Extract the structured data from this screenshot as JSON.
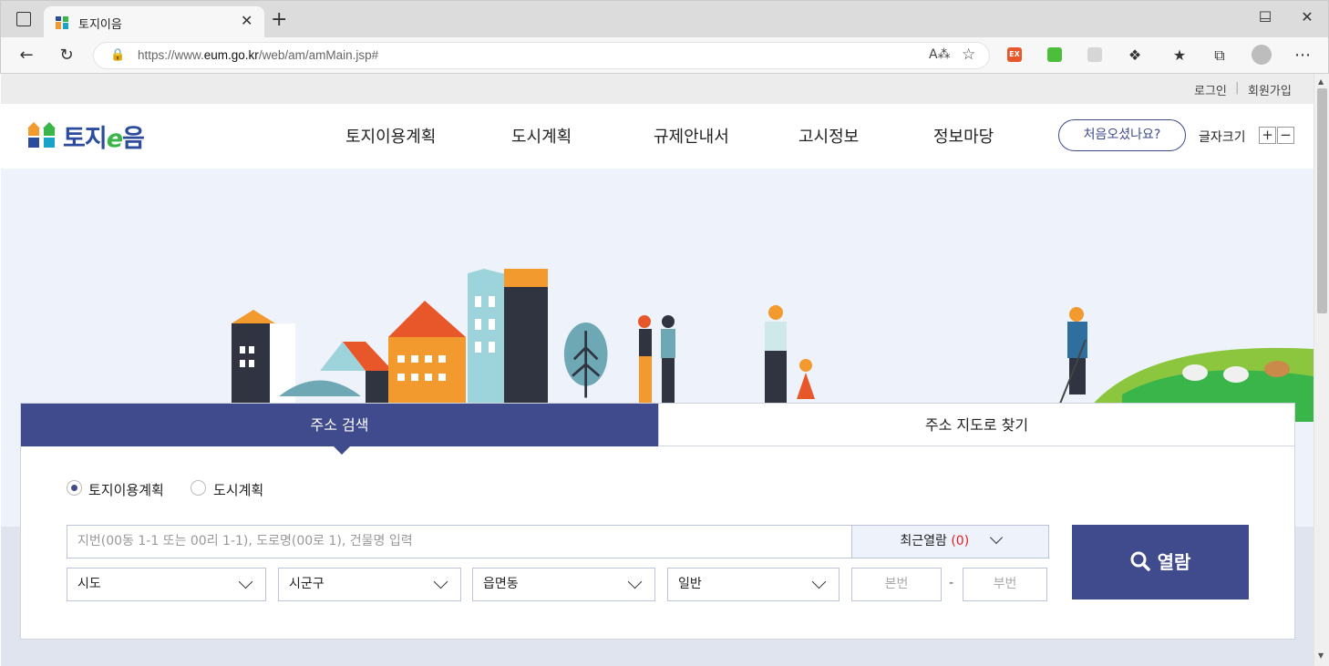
{
  "browser": {
    "tab_title": "토지이음",
    "url_prefix": "https://www.",
    "url_domain": "eum.go.kr",
    "url_path": "/web/am/amMain.jsp#",
    "new_tab": "+",
    "tab_close": "✕",
    "minimize": "—",
    "maximize": "☐",
    "close": "✕"
  },
  "util_links": {
    "login": "로그인",
    "separator": "|",
    "signup": "회원가입"
  },
  "header": {
    "logo_main": "토지",
    "logo_e": "e",
    "logo_end": "음",
    "nav": [
      "토지이용계획",
      "도시계획",
      "규제안내서",
      "고시정보",
      "정보마당"
    ],
    "first_visit": "처음오셨나요?",
    "font_size_label": "글자크기",
    "plus": "+",
    "minus": "−"
  },
  "search": {
    "tab_address": "주소 검색",
    "tab_map": "주소 지도로 찾기",
    "radio_land": "토지이용계획",
    "radio_city": "도시계획",
    "input_placeholder": "지번(00동 1-1 또는 00리 1-1), 도로명(00로 1), 건물명 입력",
    "recent_label": "최근열람",
    "recent_count": "(0)",
    "select_sido": "시도",
    "select_sigungu": "시군구",
    "select_eup": "읍면동",
    "select_type": "일반",
    "main_num": "본번",
    "sub_num": "부번",
    "dash": "-",
    "submit": "열람"
  },
  "colors": {
    "primary": "#3f4b8c",
    "accent_red": "#e02020",
    "logo_blue": "#2b4b9c",
    "logo_green": "#39b54a"
  }
}
